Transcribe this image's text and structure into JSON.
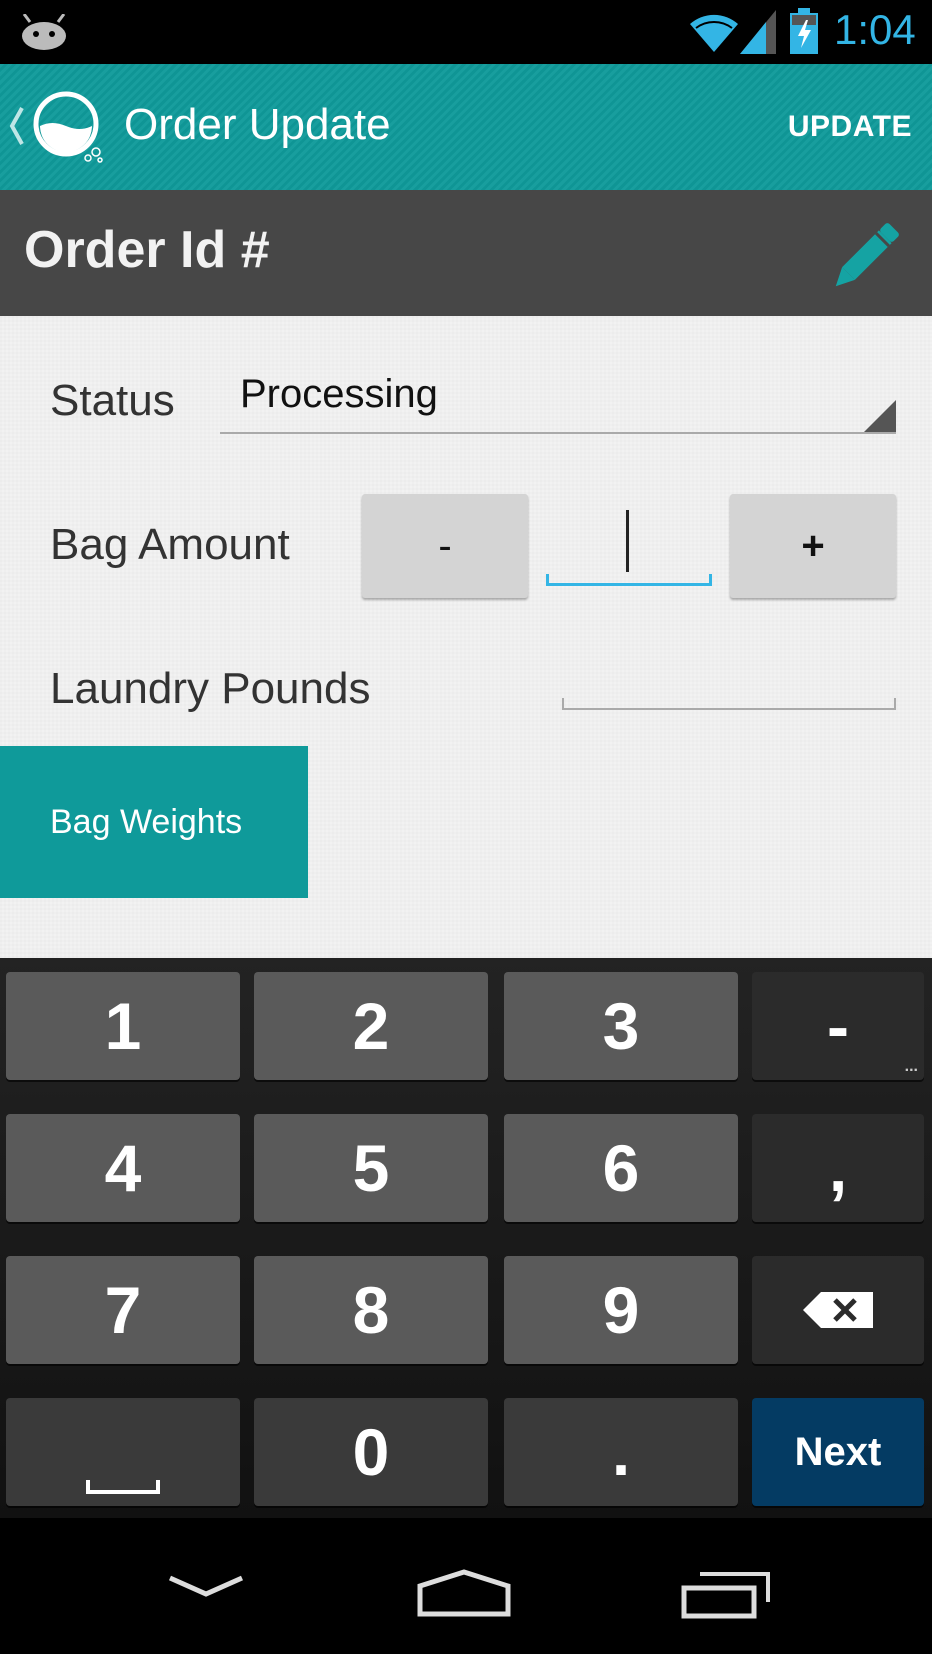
{
  "status_bar": {
    "time": "1:04",
    "icons": [
      "android-notification-icon",
      "wifi-icon",
      "cell-signal-icon",
      "battery-charging-icon"
    ]
  },
  "action_bar": {
    "title": "Order Update",
    "update_label": "UPDATE",
    "color": "#0f9a9a"
  },
  "order_header": {
    "title": "Order Id #"
  },
  "form": {
    "status_label": "Status",
    "status_value": "Processing",
    "bag_amount_label": "Bag Amount",
    "minus_label": "-",
    "plus_label": "+",
    "bag_amount_value": "",
    "laundry_pounds_label": "Laundry Pounds",
    "laundry_pounds_value": "",
    "bag_weights_label": "Bag Weights"
  },
  "keyboard": {
    "rows": [
      [
        "1",
        "2",
        "3",
        "-"
      ],
      [
        "4",
        "5",
        "6",
        ","
      ],
      [
        "7",
        "8",
        "9",
        "⌫"
      ],
      [
        "␣",
        "0",
        ".",
        "Next"
      ]
    ],
    "more_indicator": "...",
    "next_color": "#043b63"
  },
  "nav_bar": {
    "icons": [
      "back-icon",
      "home-icon",
      "recent-apps-icon"
    ]
  }
}
